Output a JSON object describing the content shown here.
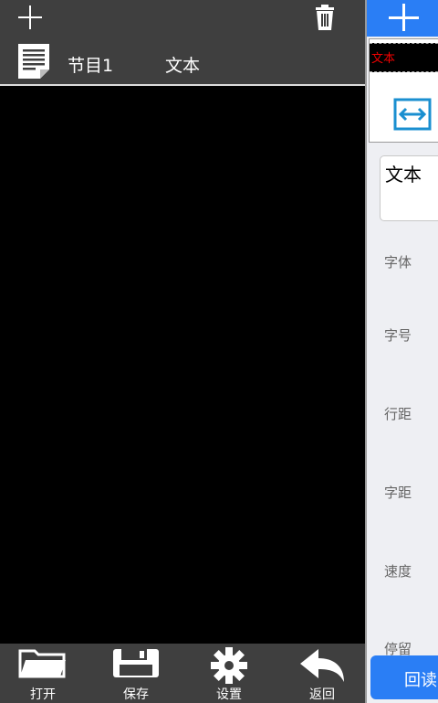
{
  "toolbar": {
    "add_icon": "plus-icon",
    "delete_icon": "trash-icon"
  },
  "program": {
    "name": "节目1",
    "type": "文本"
  },
  "bottom": {
    "open": "打开",
    "save": "保存",
    "settings": "设置",
    "back": "返回"
  },
  "side": {
    "thumb_text": "文本",
    "text_value": "文本",
    "labels": {
      "font": "字体",
      "size": "字号",
      "line_spacing": "行距",
      "char_spacing": "字距",
      "speed": "速度",
      "stay": "停留"
    },
    "readback": "回读"
  },
  "colors": {
    "accent": "#2a7ef5",
    "bar": "#3f3f3f",
    "panel": "#eeeff3",
    "thumb_text": "#e00000"
  }
}
